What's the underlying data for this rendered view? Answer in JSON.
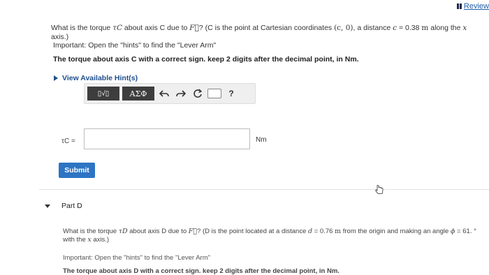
{
  "review": {
    "label": "Review"
  },
  "part_c": {
    "question_a": "What is the torque ",
    "torque_symbol": "τC",
    "question_b": " about axis C due to ",
    "force_symbol": "F⃗",
    "question_c": "? (C is the point at Cartesian coordinates ",
    "coords": "(c, 0)",
    "question_d": ", a distance ",
    "c_var": "c",
    "question_e": " = 0.38 ",
    "unit_m": "m",
    "question_f": " along the ",
    "x_var": "x",
    "question_g": " axis.)",
    "important": "Important: Open the \"hints\" to find the \"Lever Arm\"",
    "task": "The torque about axis C with a correct sign. keep 2 digits after the decimal point, in Nm.",
    "hint_link": "View Available Hint(s)",
    "toolbar": {
      "templates_label": "▯√▯",
      "greek_label": "ΑΣΦ",
      "help_label": "?"
    },
    "answer_label": "τC =",
    "answer_value": "",
    "answer_unit": "Nm",
    "submit_label": "Submit"
  },
  "part_d": {
    "title": "Part D",
    "question_a": "What is the torque ",
    "torque_symbol": "τD",
    "question_b": " about axis D due to ",
    "force_symbol": "F⃗",
    "question_c": "? (D is the point located at a distance ",
    "d_var": "d",
    "question_d": " = 0.76 ",
    "unit_m": "m",
    "question_e": " from the origin and making an angle ",
    "phi_var": "ϕ",
    "question_f": " = 61. ° with the ",
    "x_var": "x",
    "question_g": " axis.)",
    "important": "Important: Open the \"hints\" to find the \"Lever Arm\"",
    "task": "The torque about axis D with a correct sign. keep 2 digits after the decimal point, in Nm."
  }
}
